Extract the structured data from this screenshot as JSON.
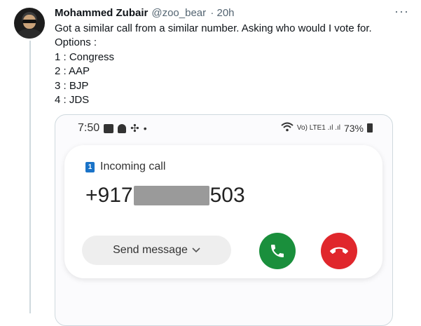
{
  "tweet": {
    "author_name": "Mohammed Zubair",
    "handle": "@zoo_bear",
    "time": "· 20h",
    "more_label": "···",
    "lines": [
      "Got a similar call from a similar number. Asking who would I vote for.",
      "Options :",
      "1 : Congress",
      "2 : AAP",
      "3 : BJP",
      "4 : JDS"
    ]
  },
  "phone": {
    "time": "7:50",
    "status_dot": "•",
    "signal_text": "Vo) LTE1 .ıl .ıl",
    "battery": "73%",
    "call_label": "Incoming call",
    "sim_number": "1",
    "number_prefix": "+917",
    "number_suffix": "503",
    "send_message": "Send message"
  },
  "colors": {
    "accept": "#1a8f3c",
    "decline": "#e0272c",
    "sim_badge": "#1a73c8",
    "redaction": "#9a9a9a"
  }
}
